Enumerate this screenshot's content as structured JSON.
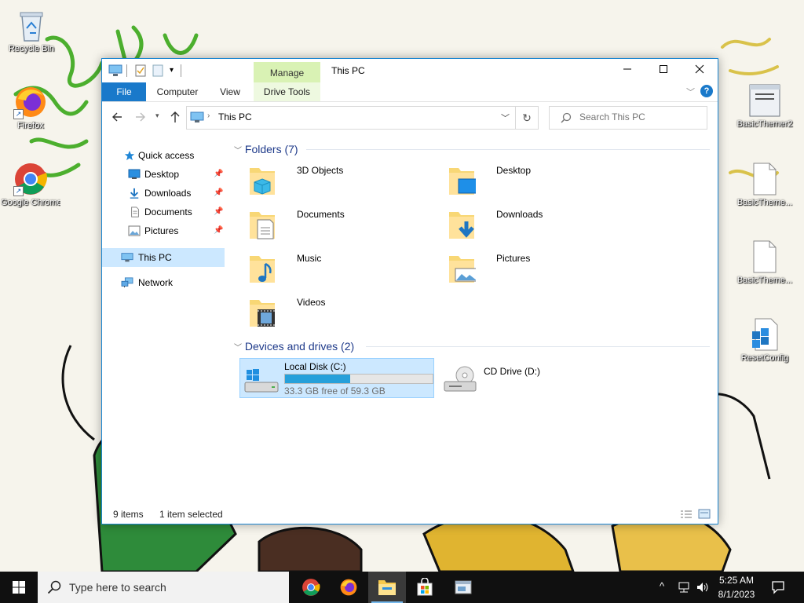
{
  "desktop": {
    "icons": [
      {
        "label": "Recycle Bin"
      },
      {
        "label": "Firefox"
      },
      {
        "label": "Google Chrome"
      },
      {
        "label": "BasicThemer2"
      },
      {
        "label": "BasicTheme..."
      },
      {
        "label": "BasicTheme..."
      },
      {
        "label": "ResetConfig"
      }
    ]
  },
  "window": {
    "title": "This PC",
    "context_tab": "Manage",
    "ribbon_tabs": [
      "File",
      "Computer",
      "View",
      "Drive Tools"
    ],
    "address": {
      "path": "This PC"
    },
    "search": {
      "placeholder": "Search This PC"
    },
    "nav": {
      "items": [
        {
          "label": "Quick access",
          "icon": "star-icon"
        },
        {
          "label": "Desktop",
          "icon": "desktop-icon",
          "pinned": true
        },
        {
          "label": "Downloads",
          "icon": "download-icon",
          "pinned": true
        },
        {
          "label": "Documents",
          "icon": "document-icon",
          "pinned": true
        },
        {
          "label": "Pictures",
          "icon": "pictures-icon",
          "pinned": true
        },
        {
          "label": "This PC",
          "icon": "computer-icon",
          "selected": true
        },
        {
          "label": "Network",
          "icon": "network-icon"
        }
      ]
    },
    "folders": {
      "heading": "Folders (7)",
      "items": [
        {
          "name": "3D Objects"
        },
        {
          "name": "Desktop"
        },
        {
          "name": "Documents"
        },
        {
          "name": "Downloads"
        },
        {
          "name": "Music"
        },
        {
          "name": "Pictures"
        },
        {
          "name": "Videos"
        }
      ]
    },
    "devices": {
      "heading": "Devices and drives (2)",
      "items": [
        {
          "name": "Local Disk (C:)",
          "detail": "33.3 GB free of 59.3 GB",
          "used_fraction": 0.44,
          "selected": true
        },
        {
          "name": "CD Drive (D:)"
        }
      ]
    },
    "status": {
      "items": "9 items",
      "selected": "1 item selected"
    }
  },
  "taskbar": {
    "search_placeholder": "Type here to search",
    "time": "5:25 AM",
    "date": "8/1/2023"
  },
  "colors": {
    "accent": "#1979ca",
    "selection": "#cce8ff",
    "selection_border": "#99d1ff",
    "drive_bar": "#26a0da"
  }
}
